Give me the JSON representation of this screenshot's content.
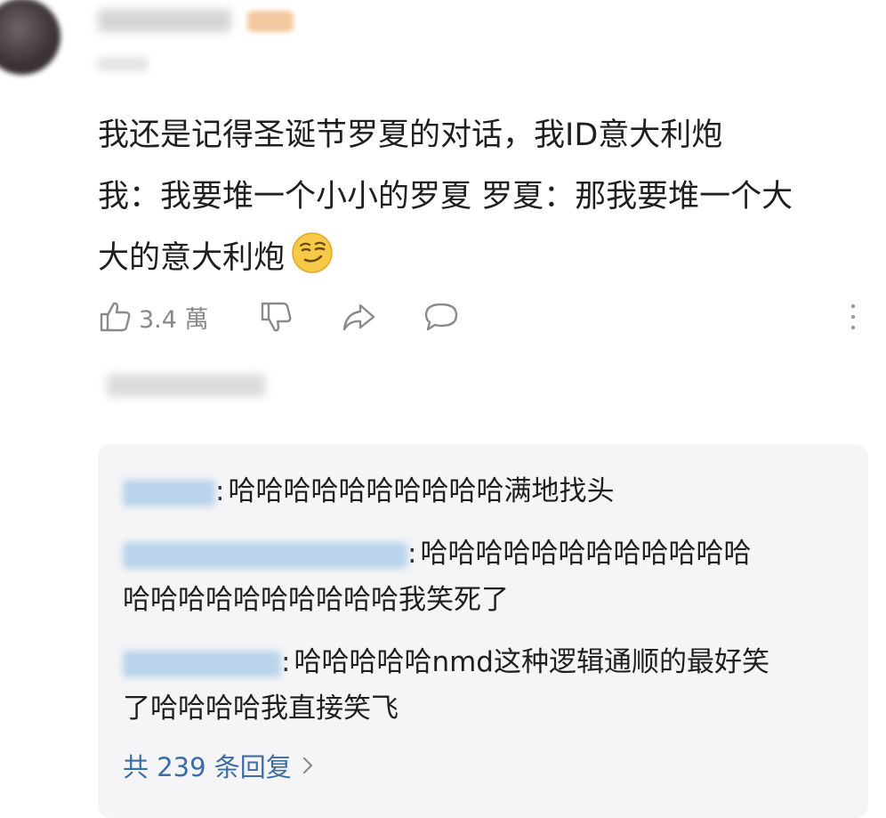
{
  "post": {
    "lines": [
      "我还是记得圣诞节罗夏的对话，我ID意大利炮",
      "我：我要堆一个小小的罗夏  罗夏：那我要堆一个大",
      "大的意大利炮"
    ],
    "emoji": "smirk-face-icon"
  },
  "actions": {
    "like_count": "3.4 萬",
    "icons": [
      "thumbs-up-icon",
      "thumbs-down-icon",
      "share-icon",
      "comment-icon",
      "more-icon"
    ]
  },
  "replies": [
    {
      "separator": ":",
      "lines": [
        "哈哈哈哈哈哈哈哈哈哈满地找头"
      ]
    },
    {
      "separator": ":",
      "lines": [
        "哈哈哈哈哈哈哈哈哈哈哈哈",
        "哈哈哈哈哈哈哈哈哈哈我笑死了"
      ]
    },
    {
      "separator": ":",
      "lines": [
        "哈哈哈哈哈nmd这种逻辑通顺的最好笑",
        "了哈哈哈哈我直接笑飞"
      ]
    }
  ],
  "reply_count_label": "共 239 条回复",
  "colors": {
    "link": "#3a6ea5",
    "reply_background": "#f5f5f7",
    "muted": "#888888"
  }
}
